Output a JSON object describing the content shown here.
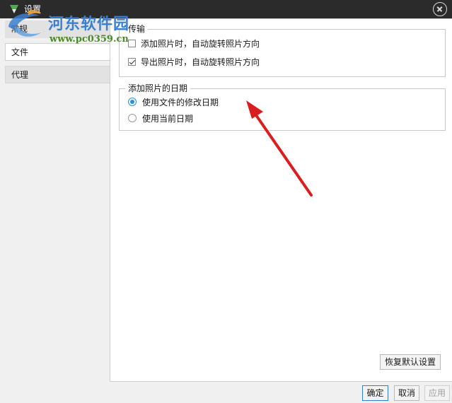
{
  "window": {
    "title": "设置"
  },
  "watermark": {
    "name": "河东软件园",
    "url": "www.pc0359.cn"
  },
  "sidebar": {
    "items": [
      {
        "label": "常规"
      },
      {
        "label": "文件",
        "selected": true
      },
      {
        "label": "代理"
      }
    ]
  },
  "transfer": {
    "title": "传输",
    "options": [
      {
        "label": "添加照片时，自动旋转照片方向",
        "checked": false
      },
      {
        "label": "导出照片时，自动旋转照片方向",
        "checked": true
      }
    ]
  },
  "photo_date": {
    "title": "添加照片的日期",
    "options": [
      {
        "label": "使用文件的修改日期",
        "selected": true
      },
      {
        "label": "使用当前日期",
        "selected": false
      }
    ]
  },
  "buttons": {
    "restore_defaults": "恢复默认设置",
    "ok": "确定",
    "cancel": "取消",
    "apply": "应用"
  },
  "colors": {
    "titlebar": "#2b2b2b",
    "accent": "#2d8fd5",
    "annotation_arrow": "#d81e1e"
  },
  "icons": {
    "app": "app-logo-icon",
    "close": "close-circle-icon",
    "annotation": "red-arrow-annotation"
  }
}
